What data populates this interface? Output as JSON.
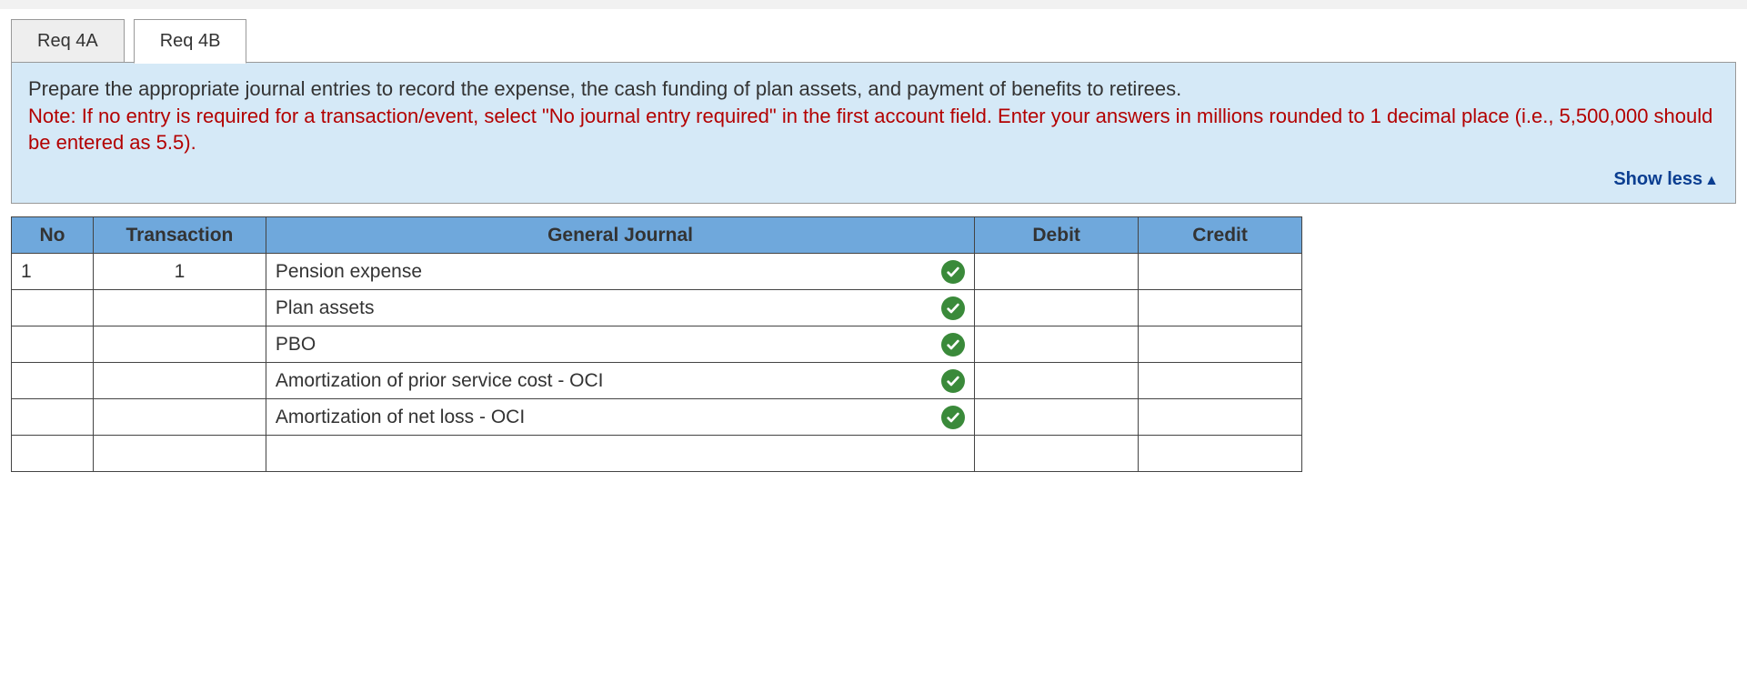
{
  "tabs": [
    {
      "label": "Req 4A",
      "active": false
    },
    {
      "label": "Req 4B",
      "active": true
    }
  ],
  "instructions": {
    "main": "Prepare the appropriate journal entries to record the expense, the cash funding of plan assets, and payment of benefits to retirees.",
    "note": "Note: If no entry is required for a transaction/event, select \"No journal entry required\" in the first account field. Enter your answers in millions rounded to 1 decimal place (i.e., 5,500,000 should be entered as 5.5)."
  },
  "show_less_label": "Show less",
  "headers": {
    "no": "No",
    "transaction": "Transaction",
    "general_journal": "General Journal",
    "debit": "Debit",
    "credit": "Credit"
  },
  "rows": [
    {
      "no": "1",
      "transaction": "1",
      "account": "Pension expense",
      "correct": true,
      "debit": "",
      "credit": ""
    },
    {
      "no": "",
      "transaction": "",
      "account": "Plan assets",
      "correct": true,
      "debit": "",
      "credit": ""
    },
    {
      "no": "",
      "transaction": "",
      "account": "PBO",
      "correct": true,
      "debit": "",
      "credit": ""
    },
    {
      "no": "",
      "transaction": "",
      "account": "Amortization of prior service cost - OCI",
      "correct": true,
      "debit": "",
      "credit": ""
    },
    {
      "no": "",
      "transaction": "",
      "account": "Amortization of net loss - OCI",
      "correct": true,
      "debit": "",
      "credit": ""
    },
    {
      "no": "",
      "transaction": "",
      "account": "",
      "correct": false,
      "debit": "",
      "credit": ""
    }
  ]
}
